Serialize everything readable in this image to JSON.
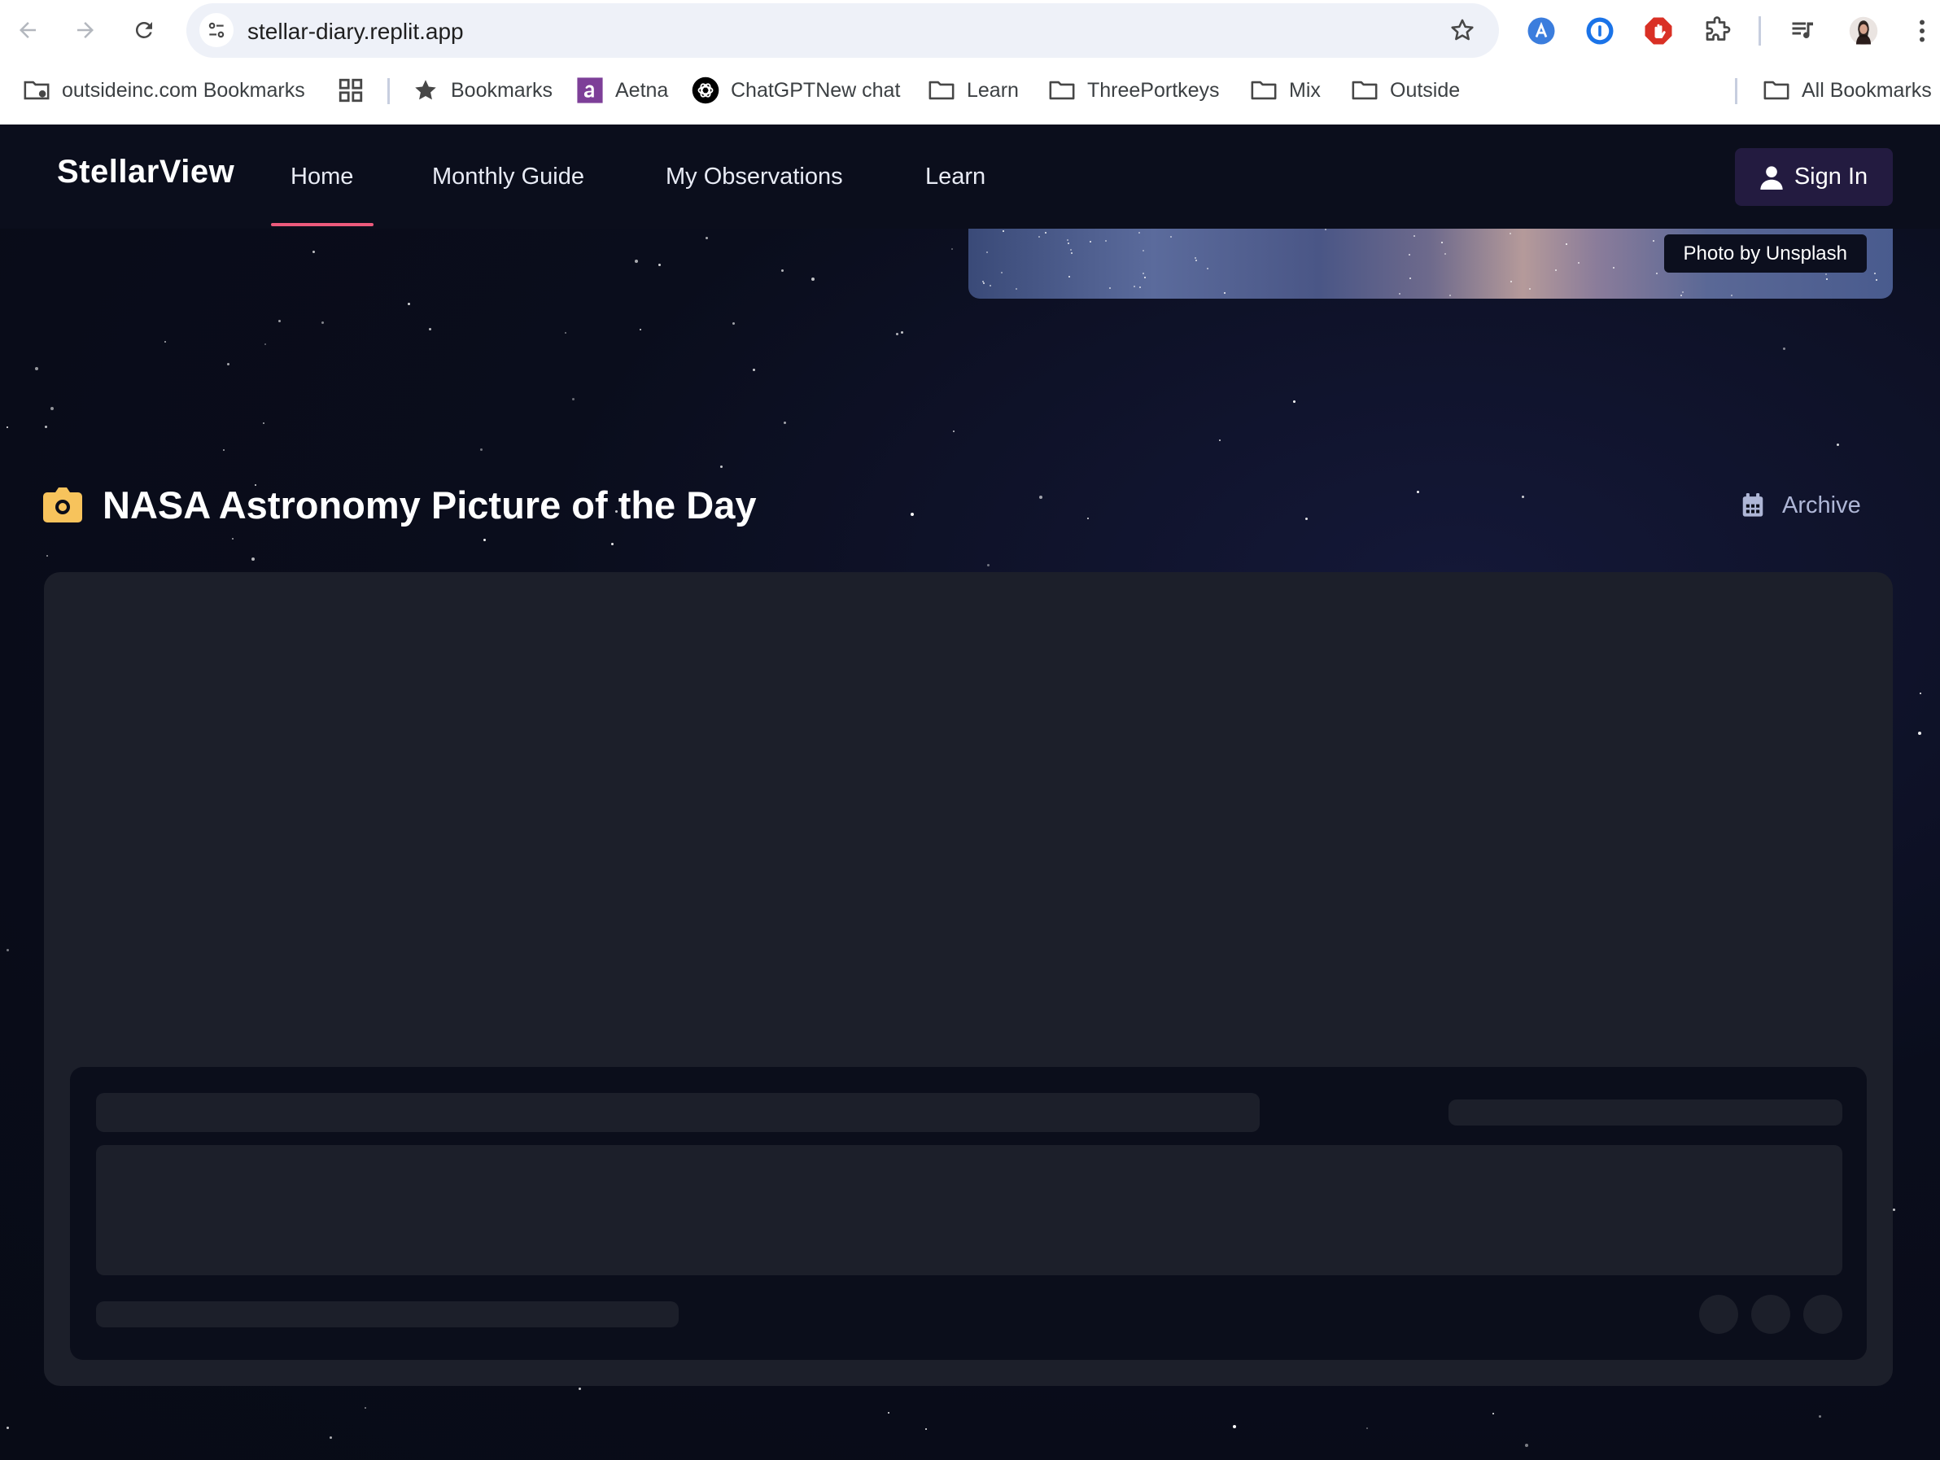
{
  "browser": {
    "url": "stellar-diary.replit.app",
    "bookmarks": [
      {
        "label": "outsideinc.com Bookmarks",
        "icon": "managed-bookmarks-icon"
      },
      {
        "label": "",
        "icon": "apps-grid-icon"
      },
      {
        "label": "Bookmarks",
        "icon": "star-icon"
      },
      {
        "label": "Aetna",
        "icon": "aetna-icon"
      },
      {
        "label": "ChatGPTNew chat",
        "icon": "chatgpt-icon"
      },
      {
        "label": "Learn",
        "icon": "folder-icon"
      },
      {
        "label": "ThreePortkeys",
        "icon": "folder-icon"
      },
      {
        "label": "Mix",
        "icon": "folder-icon"
      },
      {
        "label": "Outside",
        "icon": "folder-icon"
      }
    ],
    "all_bookmarks": "All Bookmarks"
  },
  "site": {
    "logo": "StellarView",
    "nav": [
      "Home",
      "Monthly Guide",
      "My Observations",
      "Learn"
    ],
    "active_nav": "Home",
    "sign_in": "Sign In",
    "photo_credit": "Photo by Unsplash",
    "section_title": "NASA Astronomy Picture of the Day",
    "archive_label": "Archive"
  },
  "colors": {
    "accent_underline": "#ec5a7c",
    "camera_icon": "#f7c35c",
    "sign_in_bg": "#231b40",
    "card_bg": "#1c1f2a"
  }
}
